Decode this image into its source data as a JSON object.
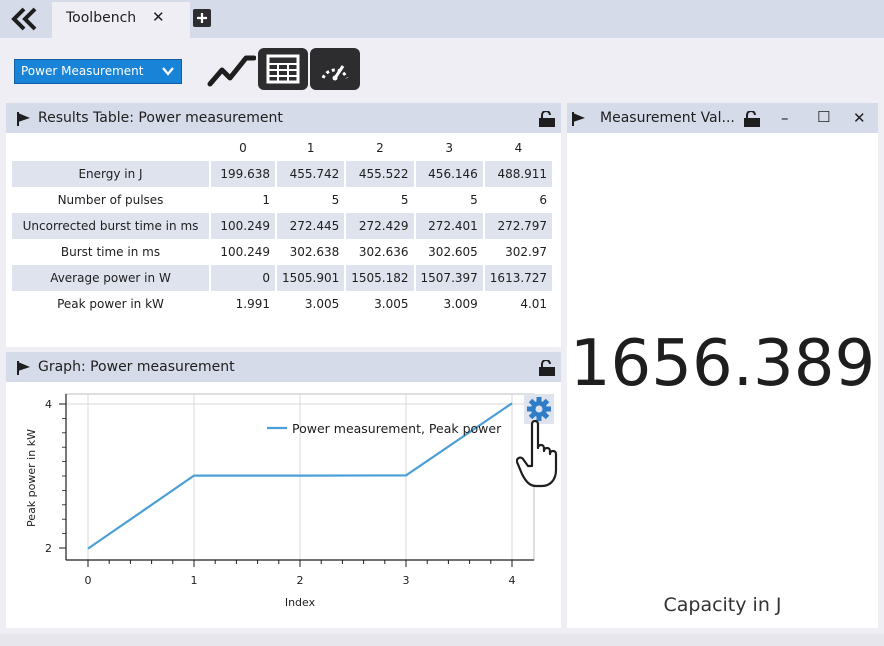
{
  "tab": {
    "label": "Toolbench",
    "close": "✕"
  },
  "toolbar": {
    "mode_select": {
      "value": "Power Measurement"
    },
    "buttons": [
      "graph-icon",
      "table-icon",
      "gauge-icon"
    ]
  },
  "results": {
    "title": "Results Table: Power measurement",
    "columns": [
      "",
      "0",
      "1",
      "2",
      "3",
      "4"
    ],
    "rows": [
      {
        "label": "Energy in J",
        "values": [
          "199.638",
          "455.742",
          "455.522",
          "456.146",
          "488.911"
        ]
      },
      {
        "label": "Number of pulses",
        "values": [
          "1",
          "5",
          "5",
          "5",
          "6"
        ]
      },
      {
        "label": "Uncorrected burst time in ms",
        "values": [
          "100.249",
          "272.445",
          "272.429",
          "272.401",
          "272.797"
        ]
      },
      {
        "label": "Burst time in ms",
        "values": [
          "100.249",
          "302.638",
          "302.636",
          "302.605",
          "302.97"
        ]
      },
      {
        "label": "Average power in W",
        "values": [
          "0",
          "1505.901",
          "1505.182",
          "1507.397",
          "1613.727"
        ]
      },
      {
        "label": "Peak power in kW",
        "values": [
          "1.991",
          "3.005",
          "3.005",
          "3.009",
          "4.01"
        ]
      }
    ]
  },
  "graph": {
    "title": "Graph: Power measurement",
    "chart_data": {
      "type": "line",
      "x": [
        0,
        1,
        2,
        3,
        4
      ],
      "series": [
        {
          "name": "Power measurement, Peak power",
          "values": [
            1.991,
            3.005,
            3.005,
            3.009,
            4.01
          ],
          "color": "#4a9fd8"
        }
      ],
      "xlabel": "Index",
      "ylabel": "Peak power in kW",
      "xticks": [
        "0",
        "1",
        "2",
        "3",
        "4"
      ],
      "yticks": [
        "2",
        "4"
      ],
      "xlim": [
        0,
        4
      ],
      "ylim": [
        2,
        4
      ],
      "grid": true,
      "legend": "top-right"
    }
  },
  "measurement": {
    "title": "Measurement Val...",
    "value": "1656.389",
    "unit": "Capacity in J",
    "controls": {
      "minimize": "–",
      "maximize": "☐",
      "close": "✕"
    }
  },
  "colors": {
    "header": "#d6dbe9",
    "accent": "#1883d7",
    "line": "#4a9fd8",
    "gear": "#2f7dc7"
  }
}
